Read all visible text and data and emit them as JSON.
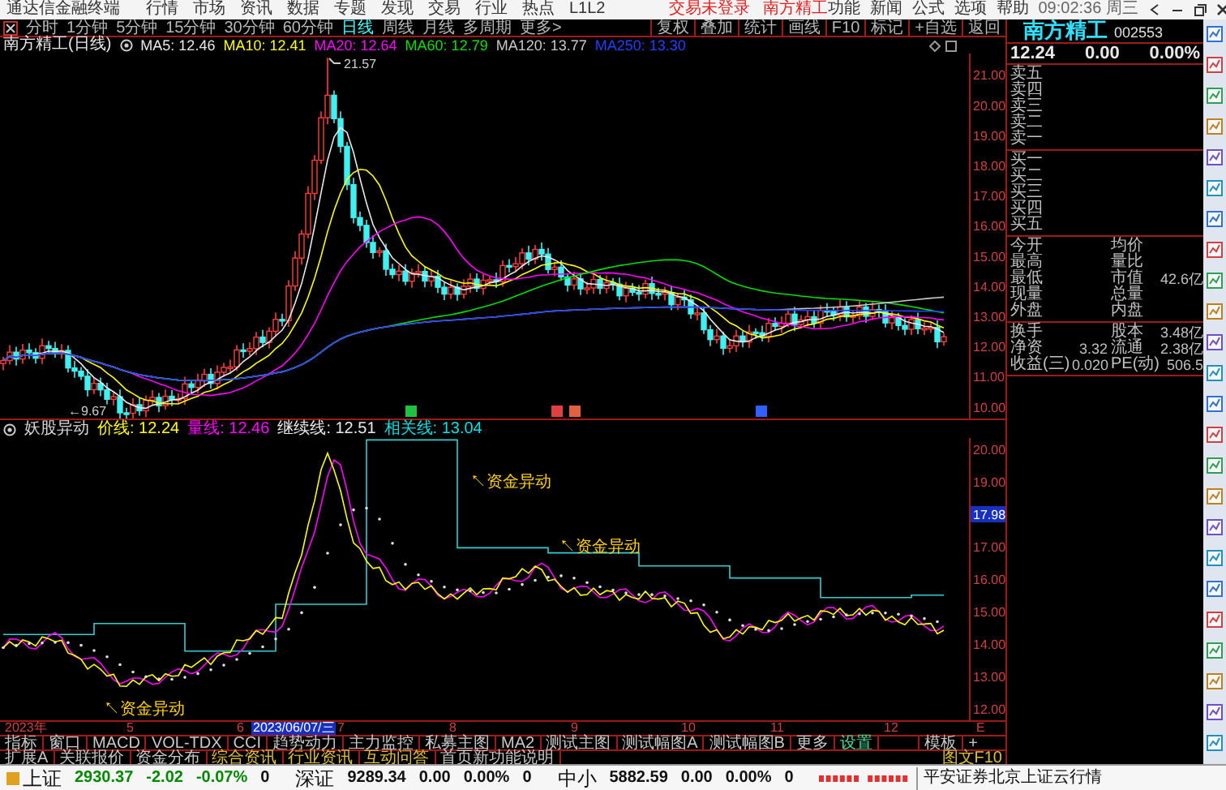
{
  "title_bar": {
    "app_name": "通达信金融终端",
    "menu": [
      "行情",
      "市场",
      "资讯",
      "数据",
      "专题",
      "发现",
      "交易",
      "行业",
      "热点",
      "L1L2"
    ],
    "notices": [
      "交易未登录",
      "南方精工"
    ],
    "links": [
      "功能",
      "新闻",
      "公式",
      "选项",
      "帮助"
    ],
    "clock": "09:02:36 周三"
  },
  "period_tabs": [
    {
      "label": "分时",
      "selected": false
    },
    {
      "label": "1分钟",
      "selected": false
    },
    {
      "label": "5分钟",
      "selected": false
    },
    {
      "label": "15分钟",
      "selected": false
    },
    {
      "label": "30分钟",
      "selected": false
    },
    {
      "label": "60分钟",
      "selected": false
    },
    {
      "label": "日线",
      "selected": true
    },
    {
      "label": "周线",
      "selected": false
    },
    {
      "label": "月线",
      "selected": false
    },
    {
      "label": "多周期",
      "selected": false
    },
    {
      "label": "更多>",
      "selected": false
    }
  ],
  "chart_tools": [
    "复权",
    "叠加",
    "统计",
    "画线",
    "F10",
    "标记",
    "+自选",
    "返回"
  ],
  "price_chart": {
    "title": "南方精工(日线)",
    "indicators": [
      {
        "text": "MA5: 12.46",
        "color": "#e8e8e8"
      },
      {
        "text": "MA10: 12.41",
        "color": "#ffff00"
      },
      {
        "text": "MA20: 12.64",
        "color": "#ff00ff"
      },
      {
        "text": "MA60: 12.79",
        "color": "#00e000"
      },
      {
        "text": "MA120: 13.77",
        "color": "#c8c8c8"
      },
      {
        "text": "MA250: 13.30",
        "color": "#2040ff"
      }
    ],
    "axis_labels": [
      "21.00",
      "20.00",
      "19.00",
      "18.00",
      "17.00",
      "16.00",
      "15.00",
      "14.00",
      "13.00",
      "12.00",
      "11.00",
      "10.00"
    ],
    "high_label": "21.57",
    "low_label": "←9.67"
  },
  "indicator_chart": {
    "title": "妖股异动",
    "readings": [
      {
        "text": "价线: 12.24",
        "color": "#ffff00"
      },
      {
        "text": "量线: 12.46",
        "color": "#ff00ff"
      },
      {
        "text": "继续线: 12.51",
        "color": "#e8e8e8"
      },
      {
        "text": "相关线: 13.04",
        "color": "#00e0e0"
      }
    ],
    "axis_labels": [
      "20.00",
      "19.00",
      "17.00",
      "16.00",
      "15.00",
      "14.00",
      "13.00",
      "12.00"
    ],
    "cursor_price": "17.98",
    "signals": [
      "↖资金异动",
      "↖资金异动",
      "↖资金异动"
    ]
  },
  "date_axis": [
    {
      "label": "2023年",
      "kind": "year"
    },
    {
      "label": "5",
      "kind": "month"
    },
    {
      "label": "6",
      "kind": "month"
    },
    {
      "label": "2023/06/07/三",
      "kind": "cursor"
    },
    {
      "label": "7",
      "kind": "month"
    },
    {
      "label": "8",
      "kind": "month"
    },
    {
      "label": "9",
      "kind": "month"
    },
    {
      "label": "10",
      "kind": "month"
    },
    {
      "label": "11",
      "kind": "month"
    },
    {
      "label": "12",
      "kind": "month"
    },
    {
      "label": "E",
      "kind": "month"
    }
  ],
  "indicator_tabs": [
    {
      "label": "指标",
      "highlighted": false
    },
    {
      "label": "窗口",
      "highlighted": false
    },
    {
      "label": "MACD",
      "highlighted": false
    },
    {
      "label": "VOL-TDX",
      "highlighted": false
    },
    {
      "label": "CCI",
      "highlighted": false
    },
    {
      "label": "趋势动力",
      "highlighted": false
    },
    {
      "label": "主力监控",
      "highlighted": false
    },
    {
      "label": "私募主图",
      "highlighted": false
    },
    {
      "label": "MA2",
      "highlighted": false
    },
    {
      "label": "测试主图",
      "highlighted": false
    },
    {
      "label": "测试幅图A",
      "highlighted": false
    },
    {
      "label": "测试幅图B",
      "highlighted": false
    },
    {
      "label": "更多",
      "highlighted": false
    },
    {
      "label": "设置",
      "highlighted": true
    }
  ],
  "template_buttons": [
    "模板",
    "+"
  ],
  "info_tabs": [
    {
      "label": "扩展A",
      "highlighted": false
    },
    {
      "label": "关联报价",
      "highlighted": false
    },
    {
      "label": "资金分布",
      "highlighted": false
    },
    {
      "label": "综合资讯",
      "highlighted": true
    },
    {
      "label": "行业资讯",
      "highlighted": true
    },
    {
      "label": "互动问答",
      "highlighted": true
    },
    {
      "label": "首页新功能说明",
      "highlighted": false
    }
  ],
  "f10_link": "图文F10",
  "quote_panel": {
    "name": "南方精工",
    "code": "002553",
    "price": "12.24",
    "change": "0.00",
    "change_pct": "0.00%",
    "asks": [
      "卖五",
      "卖四",
      "卖三",
      "卖二",
      "卖一"
    ],
    "bids": [
      "买一",
      "买二",
      "买三",
      "买四",
      "买五"
    ],
    "stats": [
      {
        "label": "今开",
        "label_2": "均价"
      },
      {
        "label": "最高",
        "label_2": "量比"
      },
      {
        "label": "最低",
        "label_2": "市值",
        "value_2": "42.6亿"
      },
      {
        "label": "现量",
        "label_2": "总量"
      },
      {
        "label": "外盘",
        "label_2": "内盘"
      }
    ],
    "fundamentals": [
      {
        "label": "换手",
        "label_2": "股本",
        "value_2": "3.48亿"
      },
      {
        "label": "净资",
        "value": "3.32",
        "label_2": "流通",
        "value_2": "2.38亿"
      },
      {
        "label": "收益(三)",
        "value": "0.020",
        "label_2": "PE(动)",
        "value_2": "506.5"
      }
    ]
  },
  "status_bar": {
    "indices": [
      {
        "name": "上证",
        "values": [
          {
            "text": "2930.37",
            "color": "#008a00"
          },
          {
            "text": "-2.02",
            "color": "#008a00"
          },
          {
            "text": "-0.07%",
            "color": "#008a00"
          },
          {
            "text": "0",
            "color": "#111111"
          }
        ]
      },
      {
        "name": "深证",
        "values": [
          {
            "text": "9289.34",
            "color": "#111111"
          },
          {
            "text": "0.00",
            "color": "#111111"
          },
          {
            "text": "0.00%",
            "color": "#111111"
          },
          {
            "text": "0",
            "color": "#111111"
          }
        ]
      },
      {
        "name": "中小",
        "values": [
          {
            "text": "5882.59",
            "color": "#111111"
          },
          {
            "text": "0.00",
            "color": "#111111"
          },
          {
            "text": "0.00%",
            "color": "#111111"
          },
          {
            "text": "0",
            "color": "#111111"
          }
        ]
      }
    ],
    "source": "平安证券北京上证云行情"
  }
}
